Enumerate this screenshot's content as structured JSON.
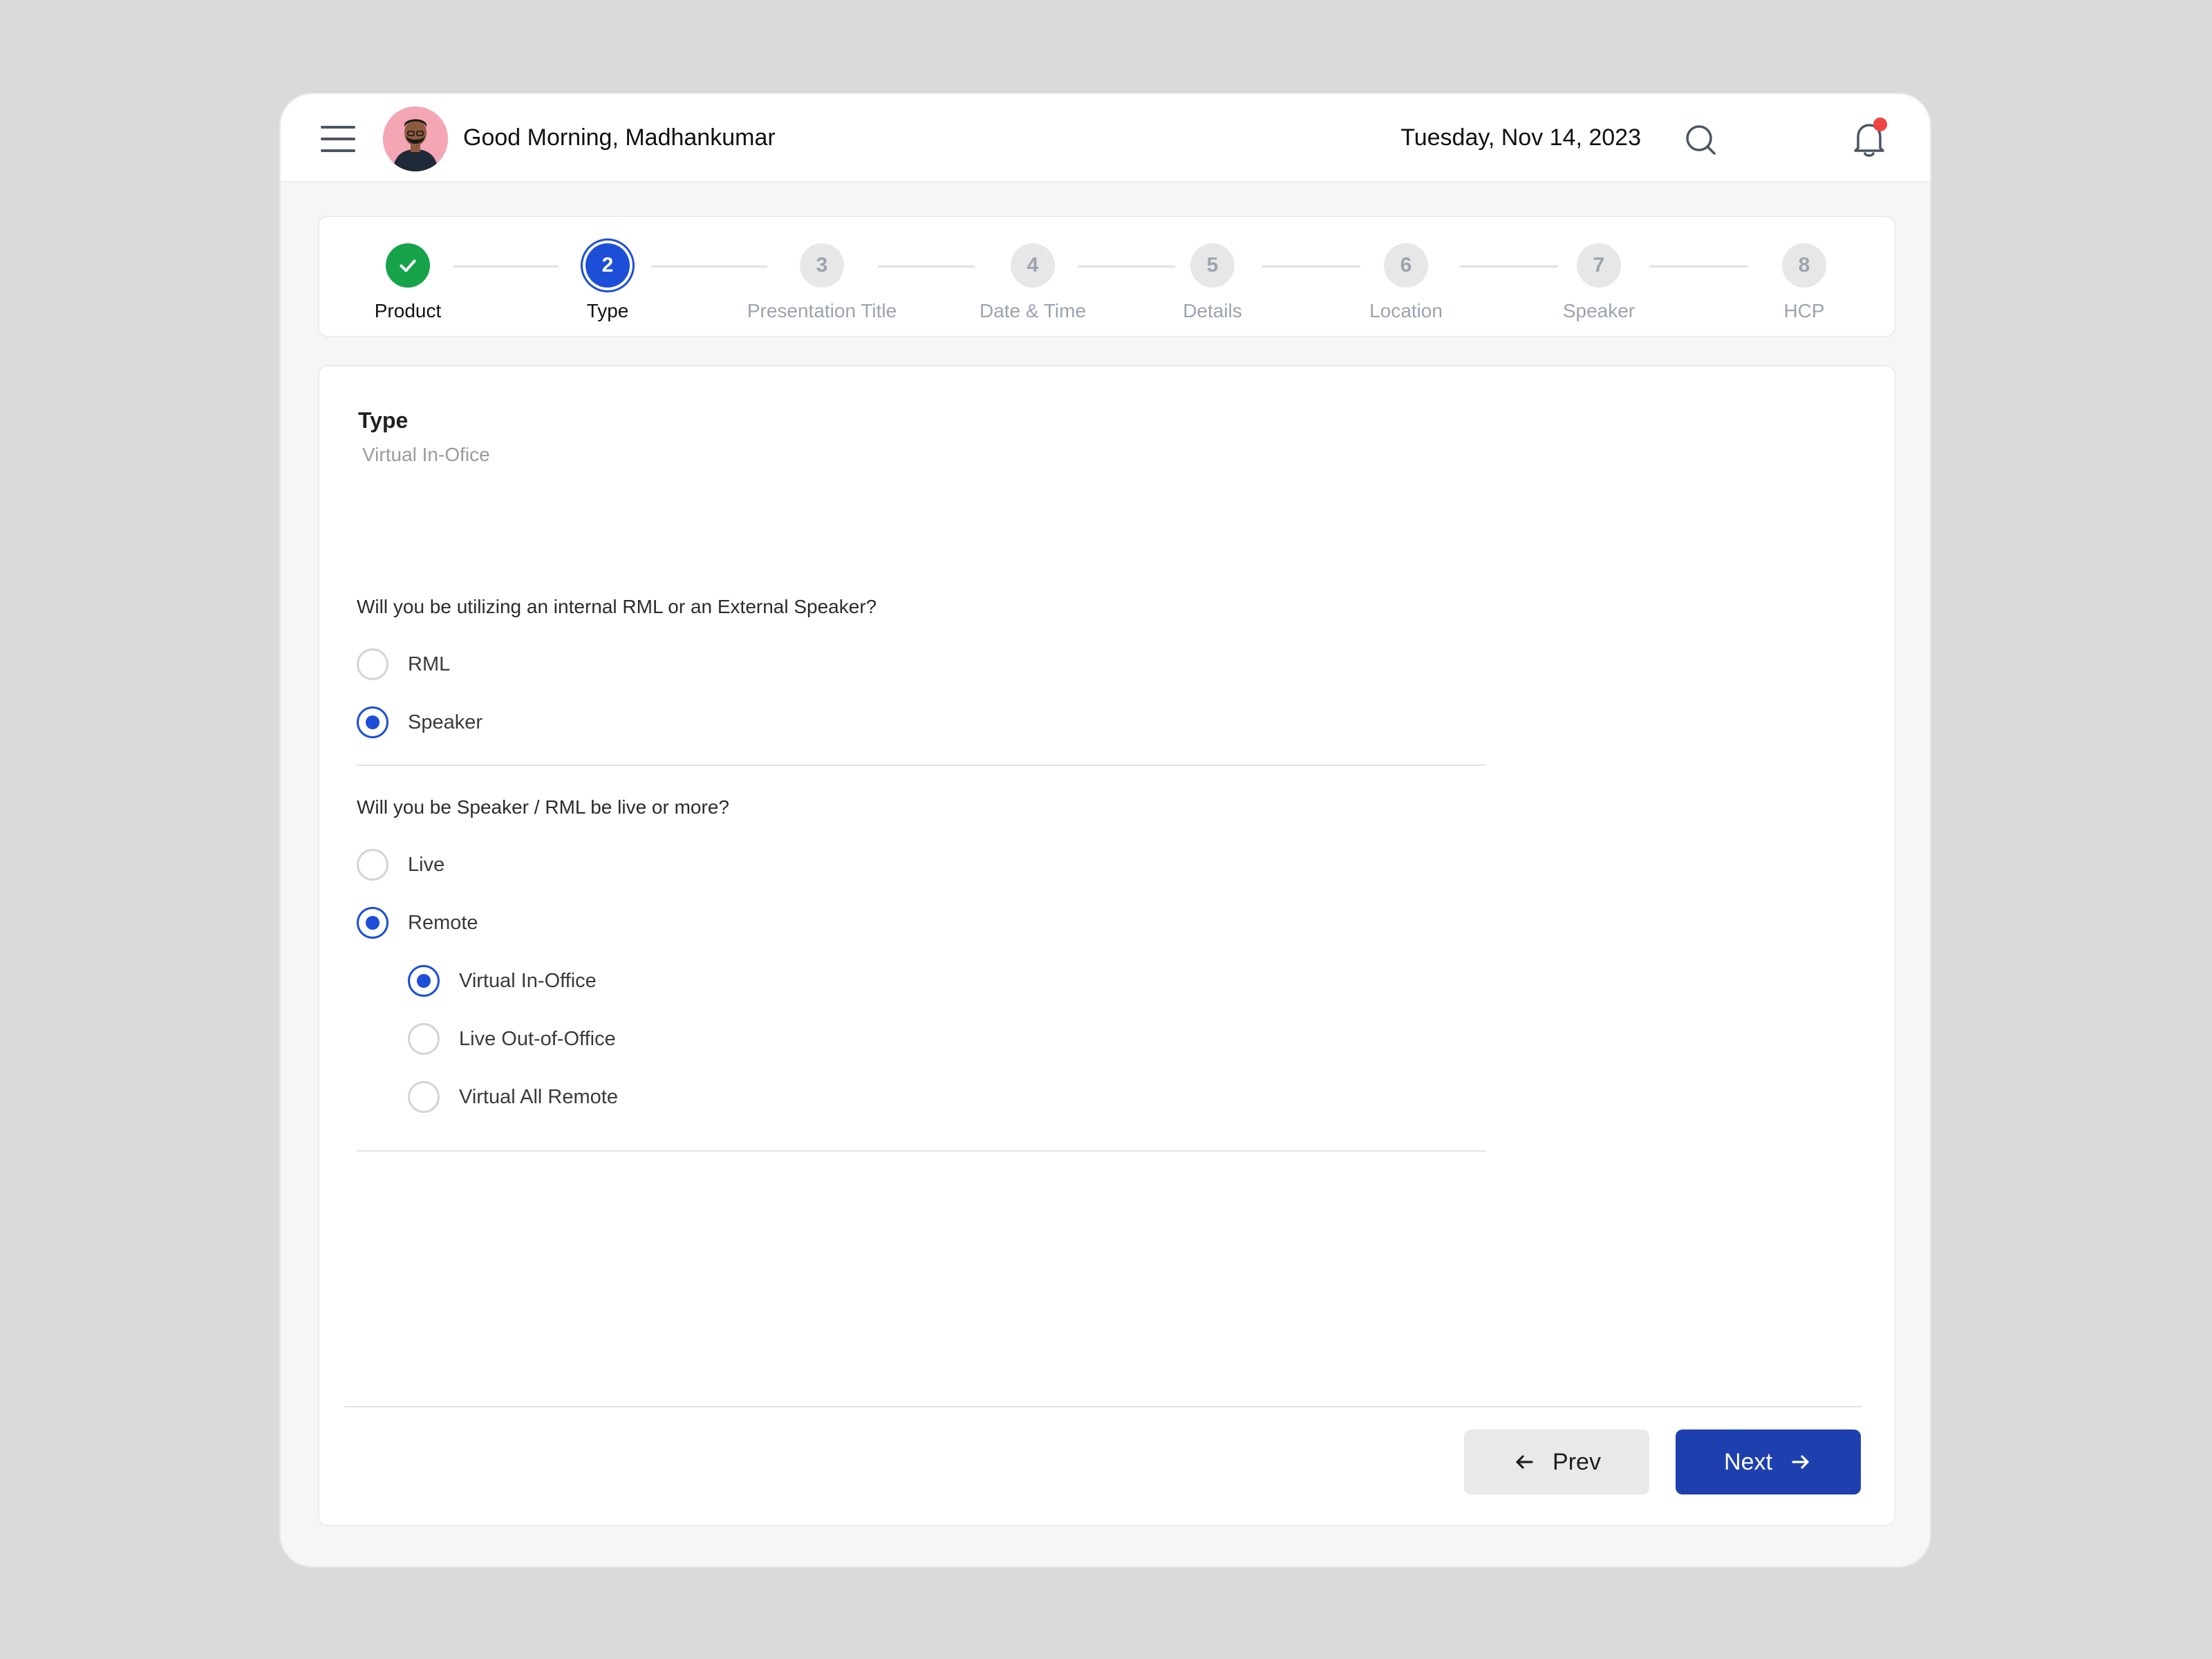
{
  "header": {
    "greeting": "Good Morning, Madhankumar",
    "date": "Tuesday, Nov 14, 2023",
    "menu_icon": "menu-icon",
    "search_icon": "search-icon",
    "notification_icon": "bell-icon",
    "notification_dot_color": "#ef4444"
  },
  "stepper": {
    "steps": [
      {
        "number": "1",
        "label": "Product",
        "state": "done"
      },
      {
        "number": "2",
        "label": "Type",
        "state": "active"
      },
      {
        "number": "3",
        "label": "Presentation Title",
        "state": "pending"
      },
      {
        "number": "4",
        "label": "Date & Time",
        "state": "pending"
      },
      {
        "number": "5",
        "label": "Details",
        "state": "pending"
      },
      {
        "number": "6",
        "label": "Location",
        "state": "pending"
      },
      {
        "number": "7",
        "label": "Speaker",
        "state": "pending"
      },
      {
        "number": "8",
        "label": "HCP",
        "state": "pending"
      }
    ]
  },
  "form": {
    "title": "Type",
    "subtitle": "Virtual In-Ofice",
    "question1": "Will you be utilizing an internal RML or an External Speaker?",
    "q1_options": [
      {
        "label": "RML",
        "checked": false
      },
      {
        "label": "Speaker",
        "checked": true
      }
    ],
    "question2": "Will you be Speaker / RML be live or more?",
    "q2_options": [
      {
        "label": "Live",
        "checked": false
      },
      {
        "label": "Remote",
        "checked": true
      }
    ],
    "remote_options": [
      {
        "label": "Virtual In-Office",
        "checked": true
      },
      {
        "label": "Live Out-of-Office",
        "checked": false
      },
      {
        "label": "Virtual All Remote",
        "checked": false
      }
    ]
  },
  "buttons": {
    "prev_label": "Prev",
    "next_label": "Next"
  },
  "colors": {
    "primary": "#1e40af",
    "success": "#16a34a"
  }
}
